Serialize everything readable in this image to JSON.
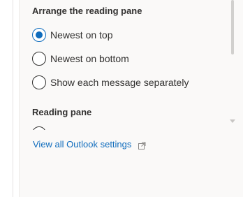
{
  "arrange_section": {
    "title": "Arrange the reading pane",
    "options": [
      {
        "label": "Newest on top",
        "checked": true
      },
      {
        "label": "Newest on bottom",
        "checked": false
      },
      {
        "label": "Show each message separately",
        "checked": false
      }
    ]
  },
  "reading_pane_section": {
    "title": "Reading pane"
  },
  "footer": {
    "view_all_link": "View all Outlook settings"
  },
  "colors": {
    "accent": "#0f6cbd",
    "panel_background": "#faf9f8",
    "text": "#323130"
  },
  "icons": {
    "external_link": "open-in-new-window-icon"
  }
}
